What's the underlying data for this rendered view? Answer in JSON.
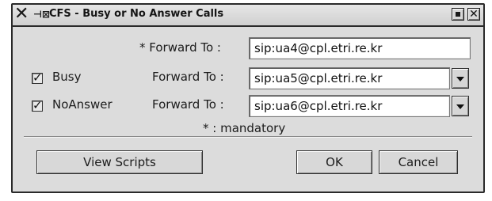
{
  "window": {
    "title": "CFS - Busy or No Answer Calls",
    "app_icon": "x-window-icon",
    "pin_icon": "pin-icon",
    "minimize_icon": "minimize-icon",
    "close_icon": "close-icon"
  },
  "form": {
    "mandatory_row": {
      "label": "* Forward To :",
      "value": "sip:ua4@cpl.etri.re.kr"
    },
    "busy_row": {
      "checkbox_label": "Busy",
      "checked": true,
      "label": "Forward To :",
      "value": "sip:ua5@cpl.etri.re.kr"
    },
    "noanswer_row": {
      "checkbox_label": "NoAnswer",
      "checked": true,
      "label": "Forward To :",
      "value": "sip:ua6@cpl.etri.re.kr"
    },
    "mandatory_note": "* : mandatory"
  },
  "buttons": {
    "view_scripts": "View Scripts",
    "ok": "OK",
    "cancel": "Cancel"
  }
}
